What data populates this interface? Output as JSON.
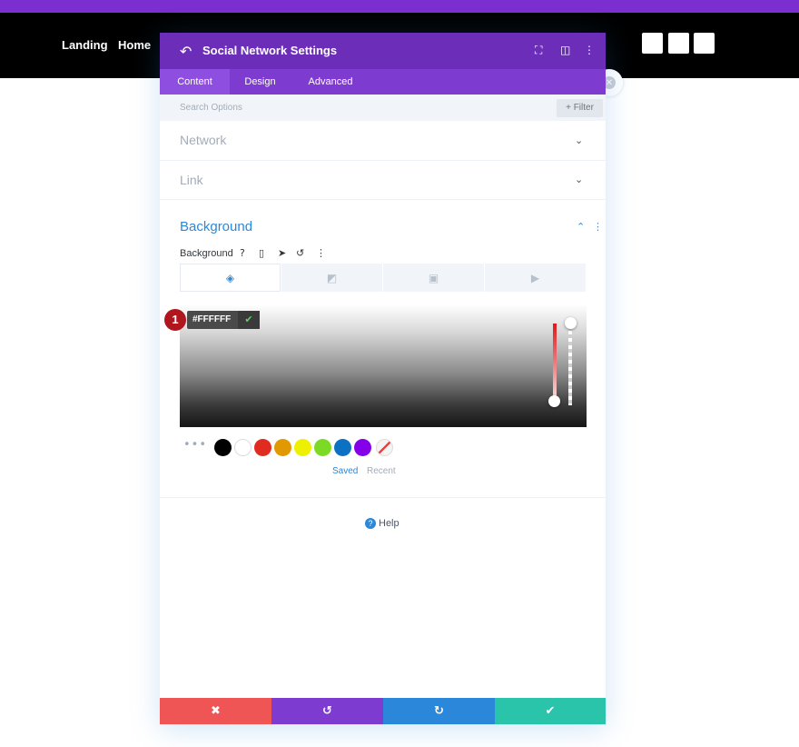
{
  "site": {
    "nav": [
      "Landing",
      "Home"
    ],
    "colors": {
      "stripe": "#7b2fd0",
      "bar": "#000000"
    }
  },
  "modal": {
    "title": "Social Network Settings",
    "header_icons": [
      "back-arrow-icon",
      "fullscreen-icon",
      "split-view-icon",
      "more-options-icon"
    ],
    "tabs": [
      {
        "label": "Content",
        "active": true
      },
      {
        "label": "Design",
        "active": false
      },
      {
        "label": "Advanced",
        "active": false
      }
    ],
    "search": {
      "placeholder": "Search Options",
      "filter_label": "Filter"
    },
    "sections": [
      {
        "title": "Network",
        "expanded": false
      },
      {
        "title": "Link",
        "expanded": false
      }
    ],
    "background": {
      "title": "Background",
      "control_label": "Background",
      "control_icons": [
        "help-icon",
        "mobile-icon",
        "pointer-icon",
        "reset-icon",
        "more-icon"
      ],
      "type_tabs": [
        "color-fill-icon",
        "gradient-icon",
        "image-icon",
        "video-icon"
      ],
      "hex_value": "#FFFFFF",
      "step_badge": "1",
      "swatches": [
        "#000000",
        "#ffffff",
        "#e02b20",
        "#e09900",
        "#edf000",
        "#7cda24",
        "#0c71c3",
        "#8300e9"
      ],
      "swatch_tabs": [
        {
          "label": "Saved",
          "active": true
        },
        {
          "label": "Recent",
          "active": false
        }
      ]
    },
    "help_label": "Help",
    "footer_colors": {
      "cancel": "#ef5555",
      "undo": "#7e3bd0",
      "redo": "#2b87da",
      "save": "#29c4a9"
    }
  }
}
